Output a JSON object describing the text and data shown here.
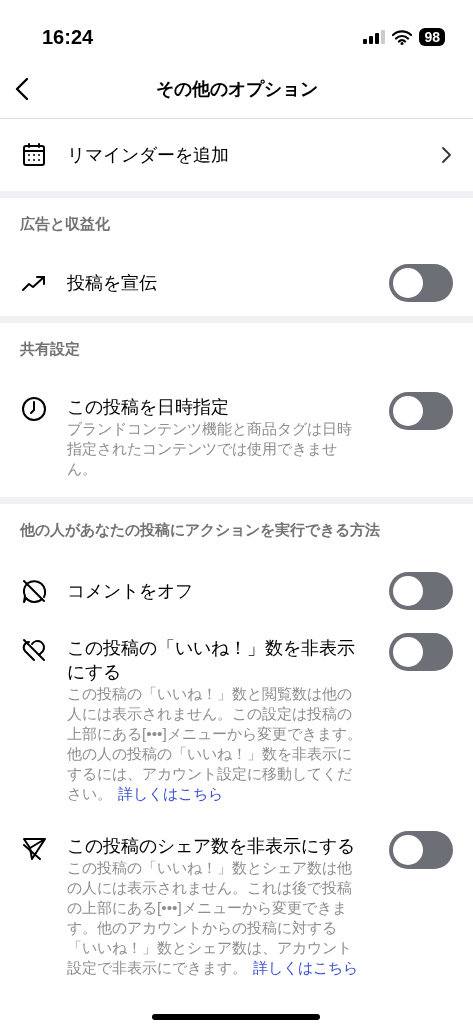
{
  "status_bar": {
    "time": "16:24",
    "battery": "98"
  },
  "nav": {
    "title": "その他のオプション"
  },
  "sections": [
    {
      "rows": [
        {
          "kind": "link",
          "label": "リマインダーを追加"
        }
      ]
    },
    {
      "header": "広告と収益化",
      "rows": [
        {
          "kind": "toggle",
          "label": "投稿を宣伝",
          "on": false
        }
      ]
    },
    {
      "header": "共有設定",
      "rows": [
        {
          "kind": "toggle",
          "label": "この投稿を日時指定",
          "description": "ブランドコンテンツ機能と商品タグは日時指定されたコンテンツでは使用できません。",
          "on": false
        }
      ]
    },
    {
      "header": "他の人があなたの投稿にアクションを実行できる方法",
      "rows": [
        {
          "kind": "toggle",
          "label": "コメントをオフ",
          "on": false
        },
        {
          "kind": "toggle",
          "label": "この投稿の「いいね！」数を非表示にする",
          "description": "この投稿の「いいね！」数と閲覧数は他の人には表示されません。この設定は投稿の上部にある[•••]メニューから変更できます。他の人の投稿の「いいね！」数を非表示にするには、アカウント設定に移動してください。",
          "link": "詳しくはこちら",
          "on": false
        },
        {
          "kind": "toggle",
          "label": "この投稿のシェア数を非表示にする",
          "description": "この投稿の「いいね！」数とシェア数は他の人には表示されません。これは後で投稿の上部にある[•••]メニューから変更できます。他のアカウントからの投稿に対する「いいね！」数とシェア数は、アカウント設定で非表示にできます。",
          "link": "詳しくはこちら",
          "on": false
        }
      ]
    }
  ]
}
